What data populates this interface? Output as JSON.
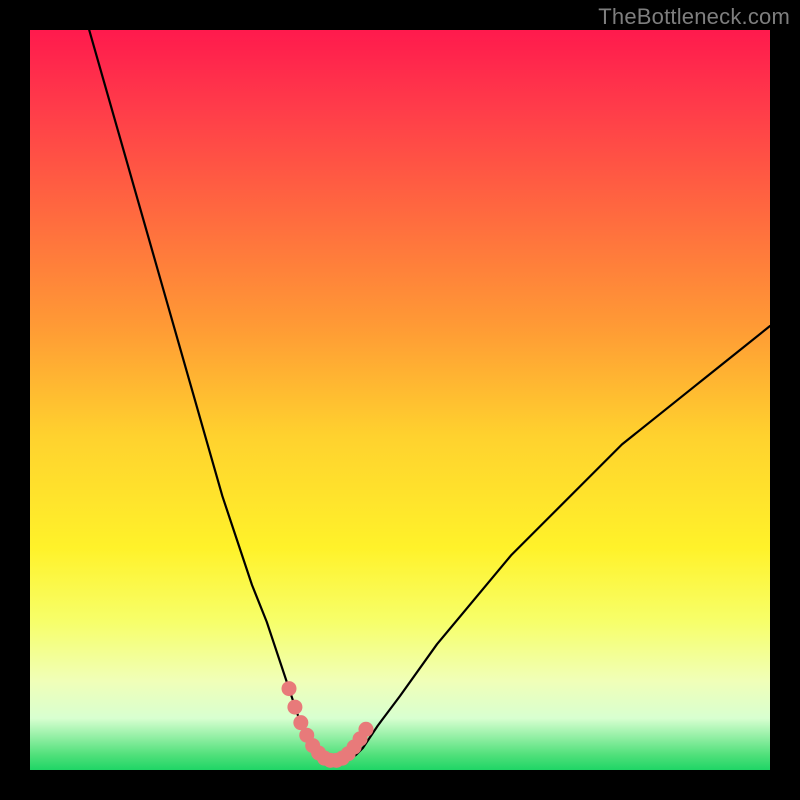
{
  "watermark": {
    "text": "TheBottleneck.com"
  },
  "colors": {
    "curve_stroke": "#000000",
    "marker_fill": "#e87a7a",
    "marker_stroke": "#c95e5e"
  },
  "chart_data": {
    "type": "line",
    "title": "",
    "xlabel": "",
    "ylabel": "",
    "xlim": [
      0,
      100
    ],
    "ylim": [
      0,
      100
    ],
    "grid": false,
    "series": [
      {
        "name": "bottleneck-curve",
        "x": [
          8,
          10,
          12,
          14,
          16,
          18,
          20,
          22,
          24,
          26,
          28,
          30,
          32,
          34,
          35,
          36,
          37,
          38,
          39,
          40,
          41,
          42,
          43,
          44,
          45,
          47,
          50,
          55,
          60,
          65,
          70,
          75,
          80,
          85,
          90,
          95,
          100
        ],
        "y": [
          100,
          93,
          86,
          79,
          72,
          65,
          58,
          51,
          44,
          37,
          31,
          25,
          20,
          14,
          11,
          8,
          5,
          3,
          2,
          1.5,
          1.3,
          1.3,
          1.5,
          2,
          3,
          6,
          10,
          17,
          23,
          29,
          34,
          39,
          44,
          48,
          52,
          56,
          60
        ]
      }
    ],
    "markers": {
      "name": "highlight-points",
      "x": [
        35.0,
        35.8,
        36.6,
        37.4,
        38.2,
        39.0,
        39.8,
        40.6,
        41.4,
        42.2,
        43.0,
        43.8,
        44.6,
        45.4
      ],
      "y": [
        11.0,
        8.5,
        6.4,
        4.7,
        3.3,
        2.3,
        1.6,
        1.3,
        1.3,
        1.6,
        2.2,
        3.1,
        4.2,
        5.5
      ]
    }
  }
}
